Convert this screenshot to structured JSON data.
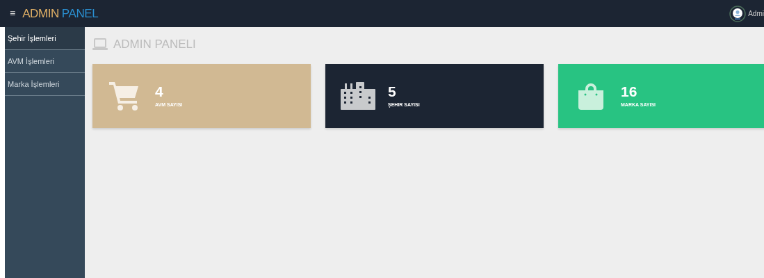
{
  "header": {
    "menu_icon": "≡",
    "brand_first": "ADMIN",
    "brand_second": "PANEL",
    "user": "Admi"
  },
  "sidebar": {
    "items": [
      {
        "label": "Şehir İşlemleri",
        "selected": true
      },
      {
        "label": "AVM İşlemleri",
        "selected": false
      },
      {
        "label": "Marka İşlemleri",
        "selected": false
      }
    ]
  },
  "page_title": "ADMIN PANELI",
  "cards": [
    {
      "kind": "cart",
      "value": "4",
      "label": "AVM SAYISI",
      "color": "#d1b993"
    },
    {
      "kind": "building",
      "value": "5",
      "label": "ŞEHIR SAYISI",
      "color": "#1c2533"
    },
    {
      "kind": "bag",
      "value": "16",
      "label": "MARKA SAYISI",
      "color": "#28c382"
    }
  ]
}
